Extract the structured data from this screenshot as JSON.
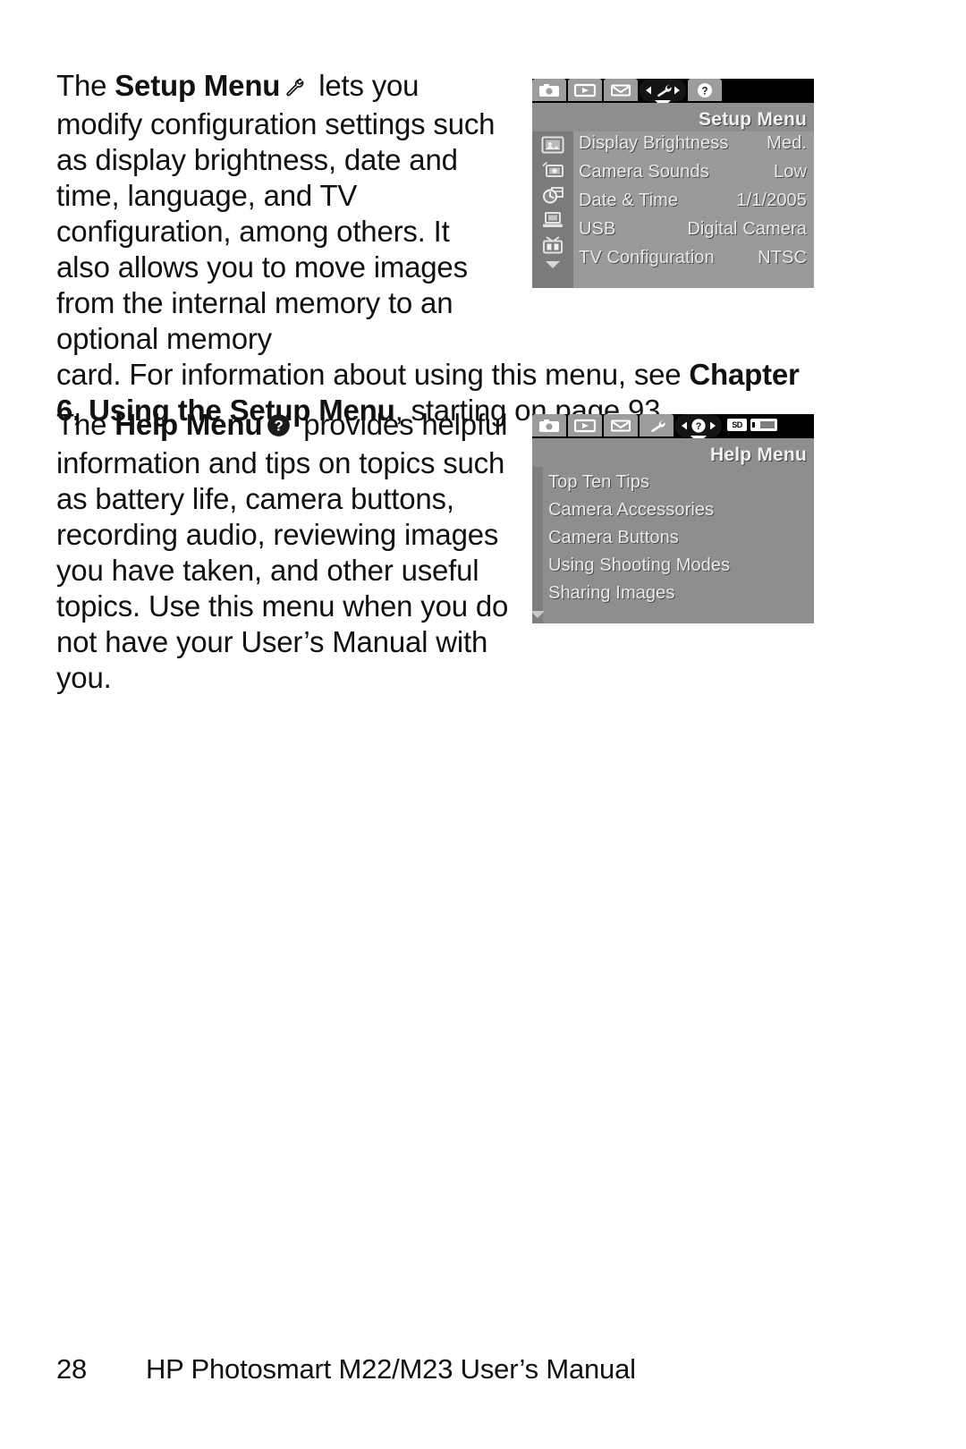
{
  "document": {
    "paragraphs": {
      "setup": {
        "lead_plain": "The ",
        "lead_bold": "Setup Menu",
        "icon_name": "wrench-icon",
        "body_narrow": " lets you modify configuration settings such as display brightness, date and time, language, and TV configuration, among others. It also allows you to move images from the internal memory to an optional memory ",
        "body_full_a": "card. For information about using this menu, see ",
        "body_full_bold": "Chapter 6, Using the Setup Menu",
        "body_full_b": ", starting on page 93."
      },
      "help": {
        "lead_plain": "The ",
        "lead_bold": "Help Menu",
        "icon_name": "help-circle-icon",
        "body": " provides helpful information and tips on topics such as battery life, camera buttons, recording audio, reviewing images you have taken, and other useful topics. Use this menu when you do not have your User’s Manual with you."
      }
    },
    "footer": {
      "page_number": "28",
      "manual_title": "HP Photosmart M22/M23 User’s Manual"
    }
  },
  "setup_screenshot": {
    "title": "Setup Menu",
    "tabs": [
      {
        "name": "capture-tab",
        "icon": "camera-icon",
        "selected": false
      },
      {
        "name": "playback-tab",
        "icon": "play-icon",
        "selected": false
      },
      {
        "name": "share-tab",
        "icon": "envelope-icon",
        "selected": false
      },
      {
        "name": "setup-tab",
        "icon": "wrench-icon",
        "selected": true
      },
      {
        "name": "help-tab",
        "icon": "help-circle-icon",
        "selected": false
      }
    ],
    "rows": [
      {
        "icon": "display-brightness-icon",
        "label": "Display Brightness",
        "value": "Med."
      },
      {
        "icon": "camera-sounds-icon",
        "label": "Camera Sounds",
        "value": "Low"
      },
      {
        "icon": "date-time-icon",
        "label": "Date & Time",
        "value": "1/1/2005"
      },
      {
        "icon": "usb-icon",
        "label": "USB",
        "value": "Digital Camera"
      },
      {
        "icon": "tv-icon",
        "label": "TV Configuration",
        "value": "NTSC"
      }
    ],
    "scroll_indicator": "chevron-down-icon"
  },
  "help_screenshot": {
    "title": "Help Menu",
    "tabs": [
      {
        "name": "capture-tab",
        "icon": "camera-icon",
        "selected": false
      },
      {
        "name": "playback-tab",
        "icon": "play-icon",
        "selected": false
      },
      {
        "name": "share-tab",
        "icon": "envelope-icon",
        "selected": false
      },
      {
        "name": "setup-tab",
        "icon": "wrench-icon",
        "selected": false
      },
      {
        "name": "help-tab",
        "icon": "help-circle-icon",
        "selected": true
      }
    ],
    "status_icons": [
      {
        "name": "memory-card-icon",
        "label": "SD"
      },
      {
        "name": "battery-icon",
        "label": ""
      }
    ],
    "items": [
      "Top Ten Tips",
      "Camera Accessories",
      "Camera Buttons",
      "Using Shooting Modes",
      "Sharing Images"
    ],
    "scroll_indicator": "chevron-down-icon"
  },
  "colors": {
    "page_background": "#ffffff",
    "text": "#111111",
    "lcd_background": "#8e8e8e",
    "lcd_panel": "#9a9a9a",
    "lcd_rail": "#7b7b7b",
    "lcd_tabbar": "#000000",
    "lcd_tab": "#9c9c9c",
    "lcd_tab_selected": "#141414",
    "lcd_text": "#e9e9e9"
  }
}
